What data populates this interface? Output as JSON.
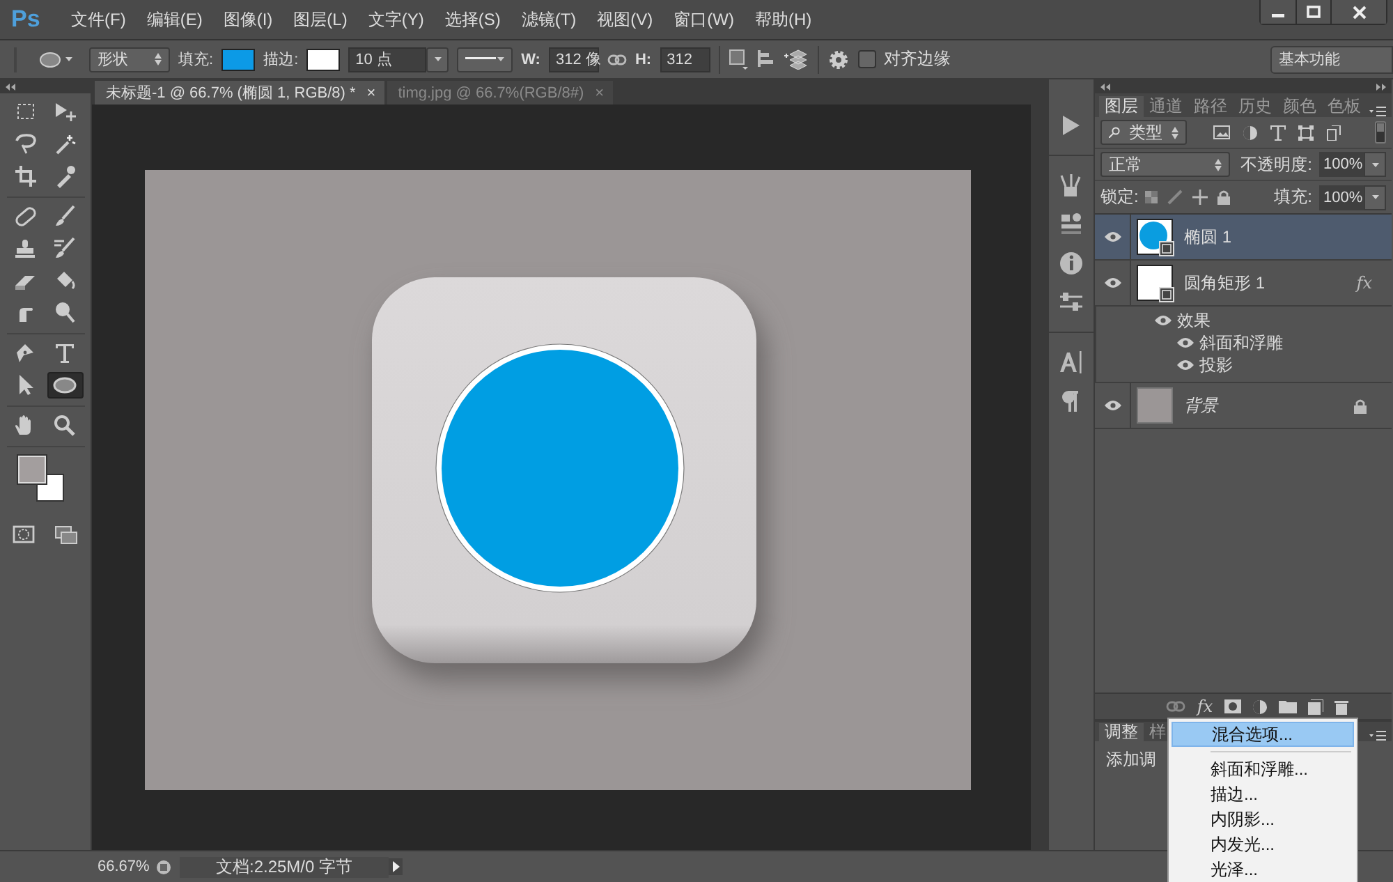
{
  "app": {
    "logo": "Ps"
  },
  "menu": [
    "文件(F)",
    "编辑(E)",
    "图像(I)",
    "图层(L)",
    "文字(Y)",
    "选择(S)",
    "滤镜(T)",
    "视图(V)",
    "窗口(W)",
    "帮助(H)"
  ],
  "options_bar": {
    "shape_mode": "形状",
    "fill_label": "填充:",
    "stroke_label": "描边:",
    "stroke_width": "10 点",
    "w_label": "W:",
    "w_value": "312 像",
    "h_label": "H:",
    "h_value": "312",
    "align_edges": {
      "label": "对齐边缘",
      "checked": false
    },
    "workspace": "基本功能"
  },
  "doc_tabs": [
    {
      "label": "未标题-1 @ 66.7% (椭圆 1, RGB/8) *",
      "close": "×",
      "selected": true
    },
    {
      "label": "timg.jpg @ 66.7%(RGB/8#)",
      "close": "×",
      "selected": false
    }
  ],
  "tools": [
    {
      "selected": false
    },
    {
      "selected": false
    },
    {
      "selected": false
    },
    {
      "selected": false
    },
    {
      "selected": false
    },
    {
      "selected": false
    },
    {
      "selected": false
    },
    {
      "selected": false
    },
    {
      "selected": false
    },
    {
      "selected": false
    },
    {
      "selected": false
    },
    {
      "selected": false
    },
    {
      "selected": false
    },
    {
      "selected": false
    },
    {
      "selected": false
    },
    {
      "selected": false
    },
    {
      "selected": false
    },
    {
      "selected": true
    },
    {
      "selected": false
    },
    {
      "selected": false
    }
  ],
  "layers_panel": {
    "tabs": [
      {
        "label": "图层",
        "selected": true
      },
      {
        "label": "通道",
        "selected": false
      },
      {
        "label": "路径",
        "selected": false
      },
      {
        "label": "历史",
        "selected": false
      },
      {
        "label": "颜色",
        "selected": false
      },
      {
        "label": "色板",
        "selected": false
      }
    ],
    "filter": "类型",
    "blend_mode": "正常",
    "opacity_label": "不透明度:",
    "opacity": "100%",
    "lock_label": "锁定:",
    "fill_label": "填充:",
    "fill": "100%",
    "layers": [
      {
        "name": "椭圆 1",
        "kind": "ellipse",
        "selected": true
      },
      {
        "name": "圆角矩形 1",
        "kind": "shape",
        "selected": false,
        "fx": "fx",
        "effects_label": "效果",
        "effects": [
          "斜面和浮雕",
          "投影"
        ]
      },
      {
        "name": "背景",
        "kind": "background",
        "selected": false,
        "locked": true
      }
    ],
    "fx_button": "fx"
  },
  "adjust_panel": {
    "tabs": [
      {
        "label": "调整",
        "selected": true
      },
      {
        "label": "样",
        "selected": false
      }
    ],
    "text": "添加调"
  },
  "context_menu": [
    {
      "label": "混合选项...",
      "selected": true,
      "divider_after": true
    },
    {
      "label": "斜面和浮雕...",
      "selected": false
    },
    {
      "label": "描边...",
      "selected": false
    },
    {
      "label": "内阴影...",
      "selected": false
    },
    {
      "label": "内发光...",
      "selected": false
    },
    {
      "label": "光泽...",
      "selected": false
    }
  ],
  "status_bar": {
    "zoom": "66.67%",
    "doc_info": "文档:2.25M/0 字节"
  }
}
